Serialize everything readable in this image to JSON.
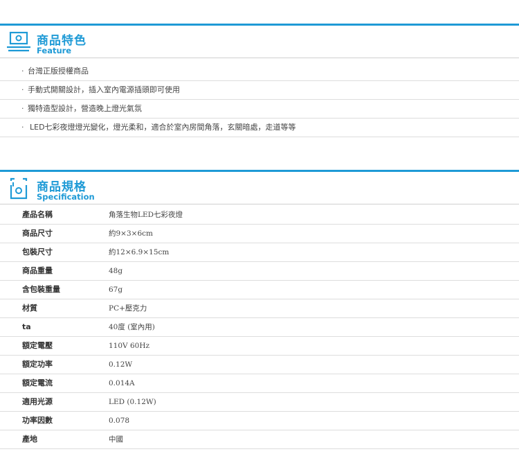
{
  "colors": {
    "accent": "#1e9ad6",
    "divider": "#dddddd"
  },
  "feature": {
    "icon": "display-stand-icon",
    "title_cn": "商品特色",
    "title_en": "Feature",
    "items": [
      "台灣正版授權商品",
      "手動式開關設計，插入室內電源插頭即可使用",
      "獨特造型設計，營造晚上燈光氣氛",
      "LED七彩夜燈燈光變化，燈光柔和，適合於室內房間角落，玄關暗處，走道等等"
    ]
  },
  "spec": {
    "icon": "framed-circle-icon",
    "title_cn": "商品規格",
    "title_en": "Specification",
    "rows": [
      {
        "key": "產品名稱",
        "value": "角落生物LED七彩夜燈"
      },
      {
        "key": "商品尺寸",
        "value": "約9×3×6cm"
      },
      {
        "key": "包裝尺寸",
        "value": "約12×6.9×15cm"
      },
      {
        "key": "商品重量",
        "value": "48g"
      },
      {
        "key": "含包裝重量",
        "value": "67g"
      },
      {
        "key": "材質",
        "value": "PC+壓克力"
      },
      {
        "key": "ta",
        "value": "40度 (室內用)"
      },
      {
        "key": "額定電壓",
        "value": "110V 60Hz"
      },
      {
        "key": "額定功率",
        "value": "0.12W"
      },
      {
        "key": "額定電流",
        "value": "0.014A"
      },
      {
        "key": "適用光源",
        "value": "LED (0.12W)"
      },
      {
        "key": "功率因數",
        "value": "0.078"
      },
      {
        "key": "產地",
        "value": "中國"
      }
    ]
  }
}
